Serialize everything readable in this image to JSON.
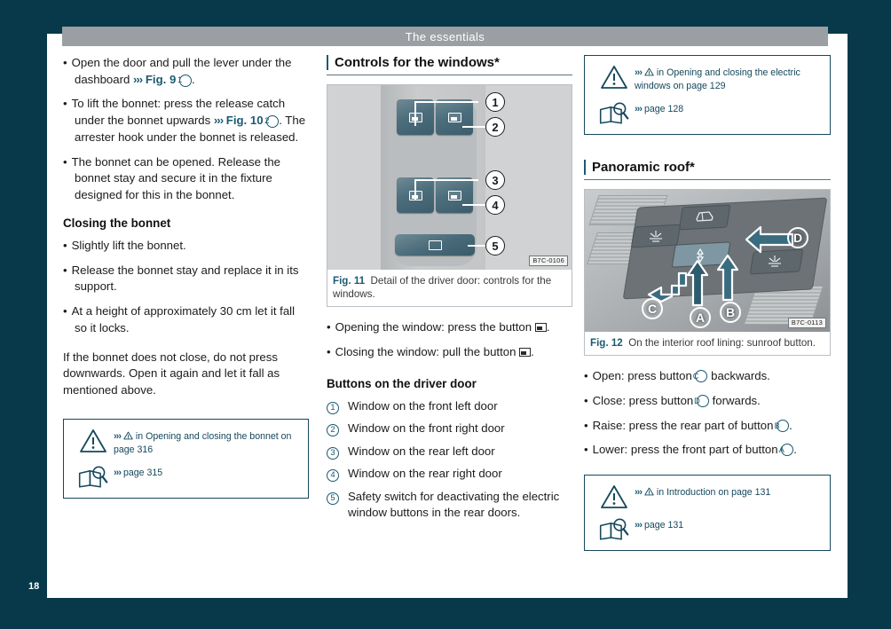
{
  "header": {
    "title": "The essentials"
  },
  "folio": {
    "page_number": "18"
  },
  "col1": {
    "bullets": [
      "Open the door and pull the lever under the dashboard",
      "To lift the bonnet: press the release catch under the bonnet upwards",
      "The bonnet can be opened. Release the bonnet stay and secure it in the fixture designed for this in the bonnet."
    ],
    "b1_ref_fig": "Fig. 9",
    "b1_ref_num": "1",
    "b1_tail": ".",
    "b2_ref_fig": "Fig. 10",
    "b2_ref_num": "2",
    "b2_tail": ". The arrester hook under the bonnet is released.",
    "subhead": "Closing the bonnet",
    "closing_bullets": [
      "Slightly lift the bonnet.",
      "Release the bonnet stay and replace it in its support.",
      "At a height of approximately 30 cm let it fall so it locks."
    ],
    "paragraph": "If the bonnet does not close, do not press downwards. Open it again and let it fall as mentioned above.",
    "ref_box": {
      "warning_text": "in Opening and closing the bonnet on page 316",
      "book_text": "page 315",
      "chevron": "›››"
    }
  },
  "col2": {
    "section_title": "Controls for the windows*",
    "figure": {
      "code": "B7C-0106",
      "caption_label": "Fig. 11",
      "caption_text": "Detail of the driver door: controls for the windows.",
      "callouts": [
        "1",
        "2",
        "3",
        "4",
        "5"
      ]
    },
    "bullets": [
      {
        "pre": "Opening the window: press the button ",
        "post": "."
      },
      {
        "pre": "Closing the window: pull the button ",
        "post": "."
      }
    ],
    "subhead": "Buttons on the driver door",
    "numbered_list": [
      {
        "num": "1",
        "text": "Window on the front left door"
      },
      {
        "num": "2",
        "text": "Window on the front right door"
      },
      {
        "num": "3",
        "text": "Window on the rear left door"
      },
      {
        "num": "4",
        "text": "Window on the rear right door"
      },
      {
        "num": "5",
        "text": "Safety switch for deactivating the electric window buttons in the rear doors."
      }
    ]
  },
  "col3": {
    "ref_box_top": {
      "warning_text": "in Opening and closing the electric windows on page 129",
      "book_text": "page 128",
      "chevron": "›››"
    },
    "section_title": "Panoramic roof*",
    "figure": {
      "code": "B7C-0113",
      "caption_label": "Fig. 12",
      "caption_text": "On the interior roof lining: sunroof button.",
      "callouts": [
        "A",
        "B",
        "C",
        "D"
      ]
    },
    "bullets": [
      {
        "pre": "Open: press button ",
        "letter": "C",
        "post": " backwards."
      },
      {
        "pre": "Close: press button ",
        "letter": "D",
        "post": " forwards."
      },
      {
        "pre": "Raise: press the rear part of button ",
        "letter": "B",
        "post": "."
      },
      {
        "pre": "Lower: press the front part of button ",
        "letter": "A",
        "post": "."
      }
    ],
    "ref_box_bottom": {
      "warning_text": "in Introduction on page 131",
      "book_text": "page 131",
      "chevron": "›››"
    }
  },
  "colors": {
    "page_bg": "#07394a",
    "header_bar": "#9b9ea2",
    "accent": "#1b5a72",
    "note_border": "#15485c"
  }
}
